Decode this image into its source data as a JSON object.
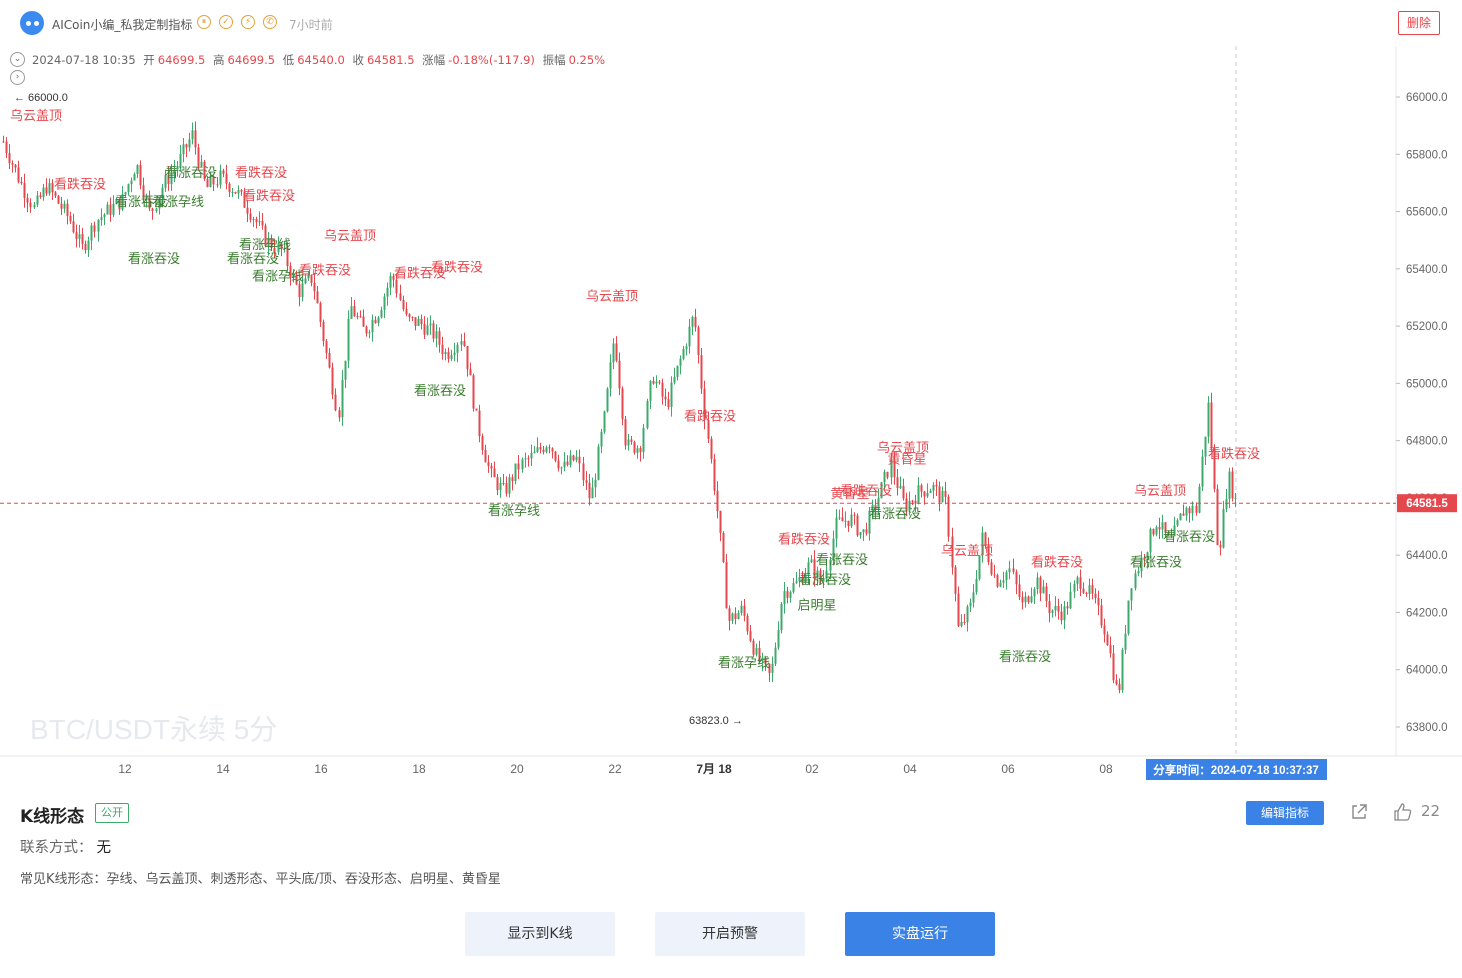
{
  "header": {
    "author": "AICoin小编_私我定制指标",
    "icons": [
      "vip-icon",
      "clock-badge-icon",
      "lightning-icon",
      "phone-icon"
    ],
    "time_ago": "7小时前",
    "delete_label": "删除"
  },
  "chart": {
    "ohlc": {
      "datetime": "2024-07-18 10:35",
      "open_label": "开",
      "open": "64699.5",
      "high_label": "高",
      "high": "64699.5",
      "low_label": "低",
      "low": "64540.0",
      "close_label": "收",
      "close": "64581.5",
      "change_label": "涨幅",
      "change": "-0.18%(-117.9)",
      "amplitude_label": "振幅",
      "amplitude": "0.25%"
    },
    "watermark": "BTC/USDT永续 5分",
    "current_price": "64581.5",
    "max_marker": "← 66000.0",
    "min_marker": "63823.0 →",
    "share_time": "分享时间：2024-07-18 10:37:37",
    "colors": {
      "up": "#3daa6b",
      "down": "#e5474d",
      "bearish_label": "#e5474d",
      "bullish_label": "#3a7d2f",
      "accent": "#3b82e6"
    }
  },
  "chart_data": {
    "type": "candlestick",
    "y_ticks": [
      "66000.0",
      "65800.0",
      "65600.0",
      "65400.0",
      "65200.0",
      "65000.0",
      "64800.0",
      "64600.0",
      "64400.0",
      "64200.0",
      "64000.0",
      "63800.0"
    ],
    "x_ticks": [
      "12",
      "14",
      "16",
      "18",
      "20",
      "22",
      "7月 18",
      "02",
      "04",
      "06",
      "08"
    ],
    "ylim": [
      63720,
      66160
    ],
    "grid": false,
    "path_points": [
      [
        0,
        65870
      ],
      [
        12,
        65770
      ],
      [
        22,
        65690
      ],
      [
        34,
        65610
      ],
      [
        46,
        65690
      ],
      [
        58,
        65630
      ],
      [
        70,
        65570
      ],
      [
        82,
        65470
      ],
      [
        96,
        65570
      ],
      [
        110,
        65610
      ],
      [
        122,
        65640
      ],
      [
        136,
        65770
      ],
      [
        150,
        65590
      ],
      [
        162,
        65690
      ],
      [
        178,
        65770
      ],
      [
        192,
        65870
      ],
      [
        206,
        65680
      ],
      [
        220,
        65720
      ],
      [
        236,
        65670
      ],
      [
        252,
        65590
      ],
      [
        266,
        65500
      ],
      [
        282,
        65460
      ],
      [
        298,
        65320
      ],
      [
        312,
        65370
      ],
      [
        328,
        65070
      ],
      [
        338,
        64890
      ],
      [
        350,
        65270
      ],
      [
        364,
        65180
      ],
      [
        378,
        65250
      ],
      [
        392,
        65380
      ],
      [
        406,
        65220
      ],
      [
        420,
        65210
      ],
      [
        434,
        65170
      ],
      [
        446,
        65100
      ],
      [
        462,
        65170
      ],
      [
        476,
        64870
      ],
      [
        490,
        64680
      ],
      [
        504,
        64620
      ],
      [
        518,
        64710
      ],
      [
        534,
        64750
      ],
      [
        548,
        64800
      ],
      [
        562,
        64700
      ],
      [
        576,
        64740
      ],
      [
        590,
        64590
      ],
      [
        604,
        64880
      ],
      [
        614,
        65170
      ],
      [
        626,
        64780
      ],
      [
        640,
        64780
      ],
      [
        652,
        65030
      ],
      [
        666,
        64920
      ],
      [
        680,
        65080
      ],
      [
        694,
        65240
      ],
      [
        704,
        64910
      ],
      [
        716,
        64580
      ],
      [
        728,
        64170
      ],
      [
        742,
        64210
      ],
      [
        756,
        64050
      ],
      [
        770,
        63970
      ],
      [
        782,
        64270
      ],
      [
        796,
        64300
      ],
      [
        810,
        64370
      ],
      [
        822,
        64300
      ],
      [
        836,
        64510
      ],
      [
        850,
        64530
      ],
      [
        862,
        64470
      ],
      [
        876,
        64580
      ],
      [
        890,
        64720
      ],
      [
        904,
        64570
      ],
      [
        918,
        64620
      ],
      [
        932,
        64640
      ],
      [
        946,
        64580
      ],
      [
        958,
        64130
      ],
      [
        970,
        64220
      ],
      [
        982,
        64460
      ],
      [
        996,
        64310
      ],
      [
        1010,
        64350
      ],
      [
        1022,
        64220
      ],
      [
        1036,
        64320
      ],
      [
        1050,
        64210
      ],
      [
        1064,
        64200
      ],
      [
        1078,
        64320
      ],
      [
        1092,
        64250
      ],
      [
        1106,
        64130
      ],
      [
        1118,
        63900
      ],
      [
        1130,
        64300
      ],
      [
        1144,
        64410
      ],
      [
        1156,
        64520
      ],
      [
        1170,
        64440
      ],
      [
        1184,
        64560
      ],
      [
        1196,
        64560
      ],
      [
        1208,
        64930
      ],
      [
        1218,
        64400
      ],
      [
        1228,
        64680
      ],
      [
        1236,
        64580
      ]
    ],
    "annotations": [
      {
        "text": "乌云盖顶",
        "type": "bearish",
        "x": 36,
        "y": 65920
      },
      {
        "text": "看跌吞没",
        "type": "bearish",
        "x": 80,
        "y": 65680
      },
      {
        "text": "看涨吞没",
        "type": "bullish",
        "x": 141,
        "y": 65620
      },
      {
        "text": "看涨孕线",
        "type": "bullish",
        "x": 178,
        "y": 65620
      },
      {
        "text": "看涨吞没",
        "type": "bullish",
        "x": 191,
        "y": 65720
      },
      {
        "text": "看涨吞没",
        "type": "bullish",
        "x": 154,
        "y": 65420
      },
      {
        "text": "看跌吞没",
        "type": "bearish",
        "x": 261,
        "y": 65720
      },
      {
        "text": "看跌吞没",
        "type": "bearish",
        "x": 269,
        "y": 65640
      },
      {
        "text": "看涨孕线",
        "type": "bullish",
        "x": 265,
        "y": 65470
      },
      {
        "text": "看涨吞没",
        "type": "bullish",
        "x": 253,
        "y": 65420
      },
      {
        "text": "看涨孕线",
        "type": "bullish",
        "x": 278,
        "y": 65360
      },
      {
        "text": "乌云盖顶",
        "type": "bearish",
        "x": 350,
        "y": 65500
      },
      {
        "text": "看跌吞没",
        "type": "bearish",
        "x": 325,
        "y": 65380
      },
      {
        "text": "看跌吞没",
        "type": "bearish",
        "x": 420,
        "y": 65370
      },
      {
        "text": "看跌吞没",
        "type": "bearish",
        "x": 457,
        "y": 65390
      },
      {
        "text": "看涨吞没",
        "type": "bullish",
        "x": 440,
        "y": 64960
      },
      {
        "text": "乌云盖顶",
        "type": "bearish",
        "x": 612,
        "y": 65290
      },
      {
        "text": "看跌吞没",
        "type": "bearish",
        "x": 710,
        "y": 64870
      },
      {
        "text": "看涨孕线",
        "type": "bullish",
        "x": 514,
        "y": 64540
      },
      {
        "text": "乌云盖顶",
        "type": "bearish",
        "x": 903,
        "y": 64760
      },
      {
        "text": "黄昏星",
        "type": "bearish",
        "x": 907,
        "y": 64720
      },
      {
        "text": "看跌吞没",
        "type": "bearish",
        "x": 866,
        "y": 64610
      },
      {
        "text": "黄昏星",
        "type": "bearish",
        "x": 850,
        "y": 64600
      },
      {
        "text": "看涨吞没",
        "type": "bullish",
        "x": 895,
        "y": 64530
      },
      {
        "text": "看跌吞没",
        "type": "bearish",
        "x": 804,
        "y": 64440
      },
      {
        "text": "看涨吞没",
        "type": "bullish",
        "x": 842,
        "y": 64370
      },
      {
        "text": "看涨吞没",
        "type": "bullish",
        "x": 825,
        "y": 64300
      },
      {
        "text": "启明星",
        "type": "bullish",
        "x": 817,
        "y": 64210
      },
      {
        "text": "乌云盖顶",
        "type": "bearish",
        "x": 967,
        "y": 64400
      },
      {
        "text": "看跌吞没",
        "type": "bearish",
        "x": 1057,
        "y": 64360
      },
      {
        "text": "看涨吞没",
        "type": "bullish",
        "x": 1025,
        "y": 64030
      },
      {
        "text": "看涨孕线",
        "type": "bullish",
        "x": 744,
        "y": 64010
      },
      {
        "text": "乌云盖顶",
        "type": "bearish",
        "x": 1160,
        "y": 64610
      },
      {
        "text": "看涨吞没",
        "type": "bullish",
        "x": 1189,
        "y": 64450
      },
      {
        "text": "看涨吞没",
        "type": "bullish",
        "x": 1156,
        "y": 64360
      },
      {
        "text": "看跌吞没",
        "type": "bearish",
        "x": 1234,
        "y": 64740
      }
    ]
  },
  "info": {
    "indicator_name": "K线形态",
    "public_badge": "公开",
    "edit_label": "编辑指标",
    "likes": "22",
    "contact_label": "联系方式：",
    "contact_value": "无",
    "description": "常见K线形态：孕线、乌云盖顶、刺透形态、平头底/顶、吞没形态、启明星、黄昏星"
  },
  "buttons": {
    "show_kline": "显示到K线",
    "enable_alert": "开启预警",
    "live_run": "实盘运行"
  }
}
